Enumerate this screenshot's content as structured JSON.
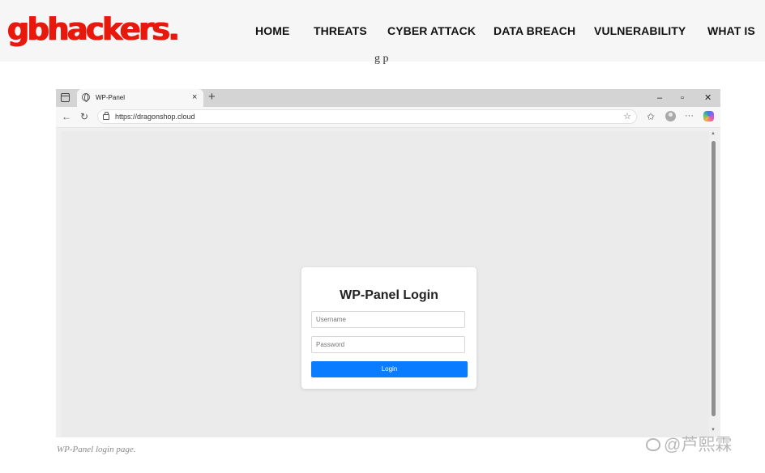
{
  "site": {
    "logo": "gbhackers.",
    "nav": [
      "HOME",
      "THREATS",
      "CYBER ATTACK",
      "DATA BREACH",
      "VULNERABILITY",
      "WHAT IS"
    ],
    "peek_text": "g p",
    "brand_color": "#e8180c"
  },
  "browser": {
    "tab_title": "WP-Panel",
    "tab_close": "×",
    "new_tab": "+",
    "window_controls": [
      "–",
      "▫",
      "✕"
    ],
    "url": "https://dragonshop.cloud",
    "icons": [
      "back-icon",
      "reload-icon",
      "lock-icon",
      "favorite-star-icon",
      "favorites-icon",
      "profile-icon",
      "more-icon",
      "copilot-icon"
    ]
  },
  "login": {
    "title": "WP-Panel Login",
    "username_placeholder": "Username",
    "password_placeholder": "Password",
    "button_label": "Login",
    "button_color": "#0a7cff"
  },
  "caption": "WP-Panel login page.",
  "watermark": "@芦熙霖"
}
